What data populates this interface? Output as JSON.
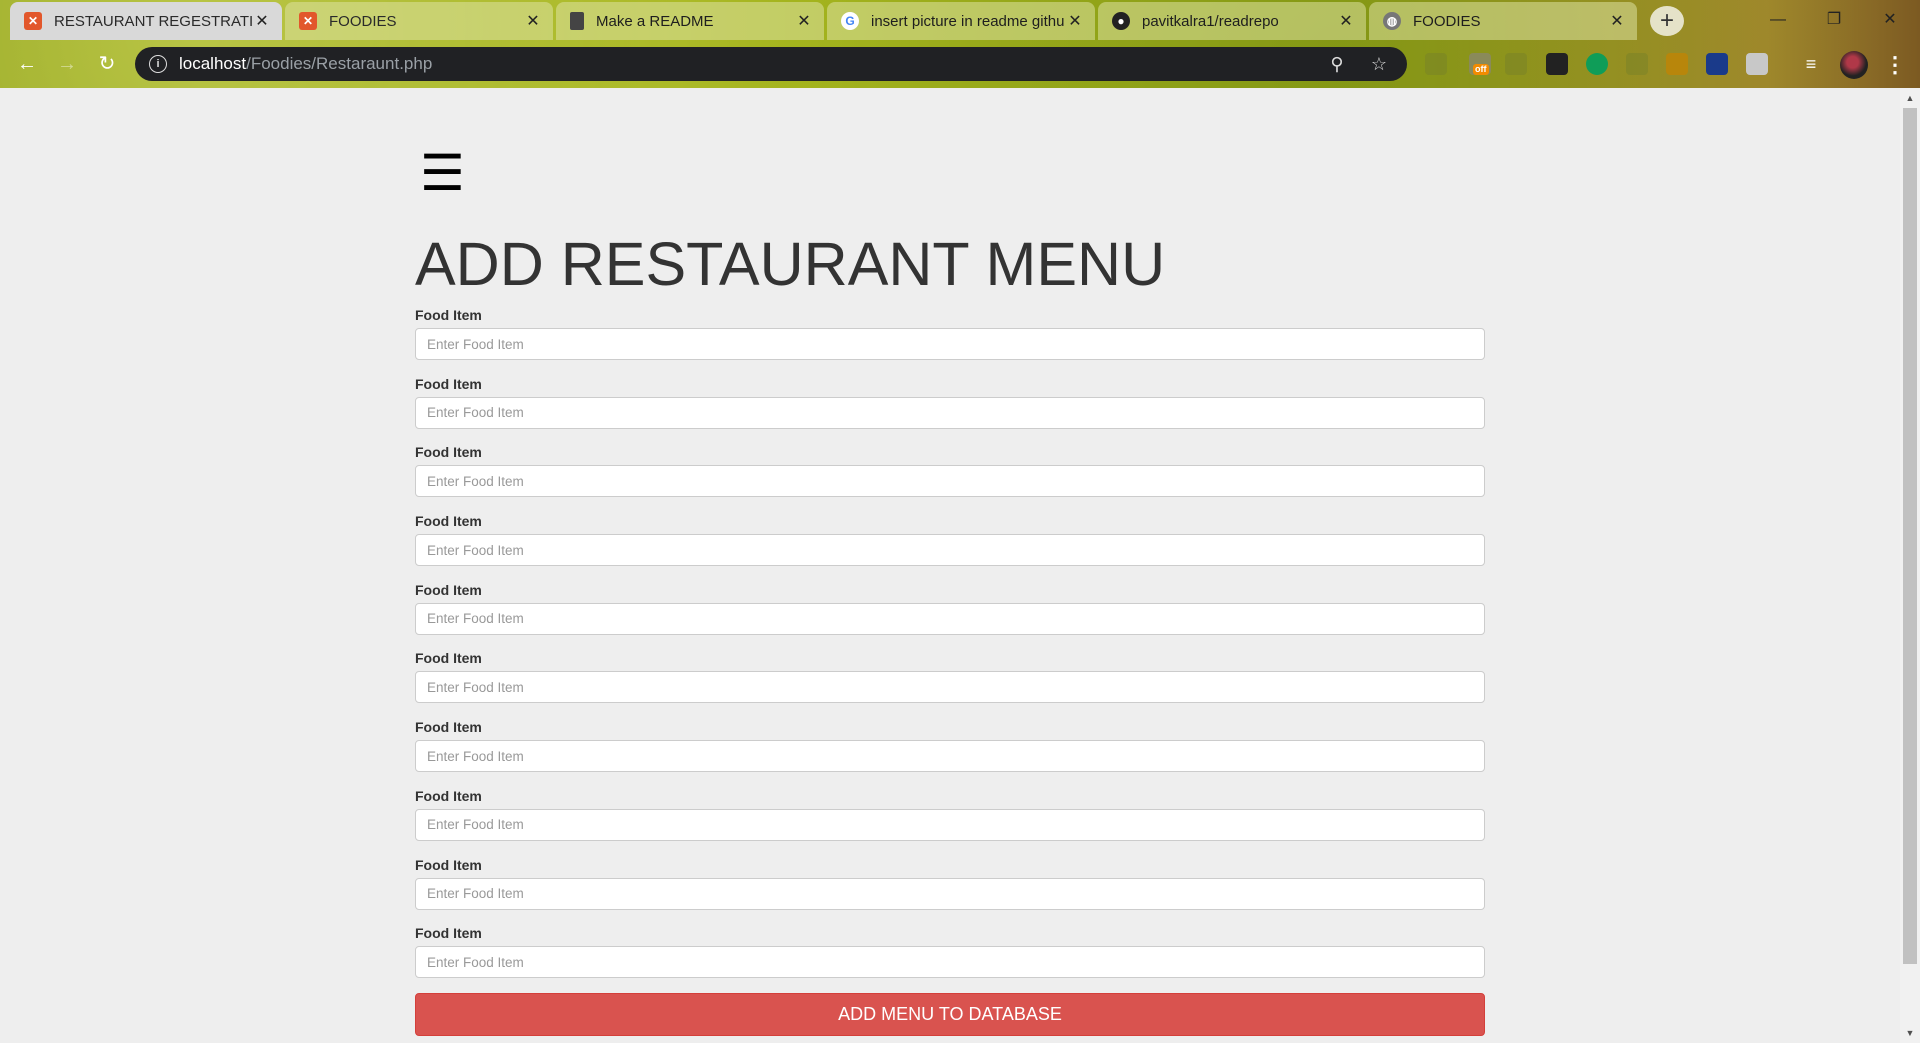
{
  "browser": {
    "tabs": [
      {
        "title": "RESTAURANT REGESTRATION",
        "icon": "xampp-icon",
        "state": "active"
      },
      {
        "title": "FOODIES",
        "icon": "xampp-icon",
        "state": "inactive"
      },
      {
        "title": "Make a README",
        "icon": "document-icon",
        "state": "inactive"
      },
      {
        "title": "insert picture in readme github",
        "icon": "google-icon",
        "state": "inactive"
      },
      {
        "title": "pavitkalra1/readrepo",
        "icon": "github-icon",
        "state": "inactive"
      },
      {
        "title": "FOODIES",
        "icon": "globe-icon",
        "state": "inactive"
      }
    ],
    "new_tab_label": "+",
    "address": {
      "host": "localhost",
      "path": "/Foodies/Restaraunt.php"
    },
    "extension_badge": "off"
  },
  "page": {
    "menu_icon": "☰",
    "title": "ADD RESTAURANT MENU",
    "fields": [
      {
        "label": "Food Item",
        "placeholder": "Enter Food Item"
      },
      {
        "label": "Food Item",
        "placeholder": "Enter Food Item"
      },
      {
        "label": "Food Item",
        "placeholder": "Enter Food Item"
      },
      {
        "label": "Food Item",
        "placeholder": "Enter Food Item"
      },
      {
        "label": "Food Item",
        "placeholder": "Enter Food Item"
      },
      {
        "label": "Food Item",
        "placeholder": "Enter Food Item"
      },
      {
        "label": "Food Item",
        "placeholder": "Enter Food Item"
      },
      {
        "label": "Food Item",
        "placeholder": "Enter Food Item"
      },
      {
        "label": "Food Item",
        "placeholder": "Enter Food Item"
      },
      {
        "label": "Food Item",
        "placeholder": "Enter Food Item"
      }
    ],
    "submit_label": "ADD MENU TO DATABASE"
  },
  "colors": {
    "submit_button": "#d9534f",
    "page_background": "#eeeeee",
    "title_text": "#333333"
  }
}
